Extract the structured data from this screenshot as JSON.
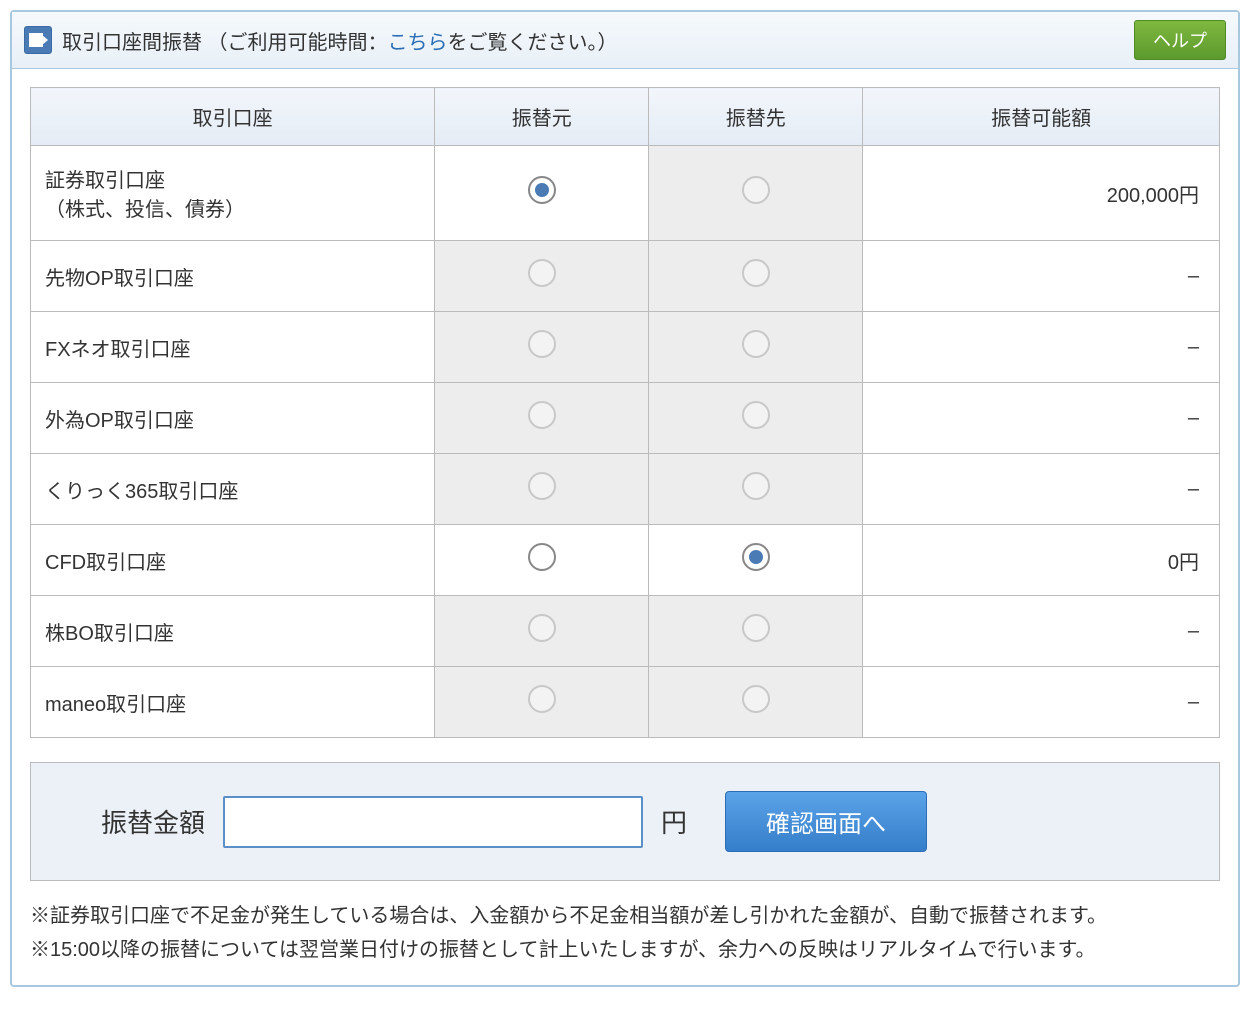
{
  "header": {
    "title_prefix": "取引口座間振替 （ご利用可能時間：",
    "title_link": "こちら",
    "title_suffix": "をご覧ください。）",
    "help_label": "ヘルプ"
  },
  "table": {
    "headers": {
      "account": "取引口座",
      "from": "振替元",
      "to": "振替先",
      "available": "振替可能額"
    },
    "rows": [
      {
        "name_line1": "証券取引口座",
        "name_line2": "（株式、投信、債券）",
        "from_selected": true,
        "from_enabled": true,
        "to_selected": false,
        "to_enabled": false,
        "amount": "200,000円"
      },
      {
        "name_line1": "先物OP取引口座",
        "name_line2": "",
        "from_selected": false,
        "from_enabled": false,
        "to_selected": false,
        "to_enabled": false,
        "amount": "–"
      },
      {
        "name_line1": "FXネオ取引口座",
        "name_line2": "",
        "from_selected": false,
        "from_enabled": false,
        "to_selected": false,
        "to_enabled": false,
        "amount": "–"
      },
      {
        "name_line1": "外為OP取引口座",
        "name_line2": "",
        "from_selected": false,
        "from_enabled": false,
        "to_selected": false,
        "to_enabled": false,
        "amount": "–"
      },
      {
        "name_line1": "くりっく365取引口座",
        "name_line2": "",
        "from_selected": false,
        "from_enabled": false,
        "to_selected": false,
        "to_enabled": false,
        "amount": "–"
      },
      {
        "name_line1": "CFD取引口座",
        "name_line2": "",
        "from_selected": false,
        "from_enabled": true,
        "to_selected": true,
        "to_enabled": true,
        "amount": "0円"
      },
      {
        "name_line1": "株BO取引口座",
        "name_line2": "",
        "from_selected": false,
        "from_enabled": false,
        "to_selected": false,
        "to_enabled": false,
        "amount": "–"
      },
      {
        "name_line1": "maneo取引口座",
        "name_line2": "",
        "from_selected": false,
        "from_enabled": false,
        "to_selected": false,
        "to_enabled": false,
        "amount": "–"
      }
    ]
  },
  "transfer": {
    "label": "振替金額",
    "unit": "円",
    "input_value": "",
    "confirm_label": "確認画面へ"
  },
  "notes": {
    "line1": "※証券取引口座で不足金が発生している場合は、入金額から不足金相当額が差し引かれた金額が、自動で振替されます。",
    "line2": "※15:00以降の振替については翌営業日付けの振替として計上いたしますが、余力への反映はリアルタイムで行います。"
  }
}
